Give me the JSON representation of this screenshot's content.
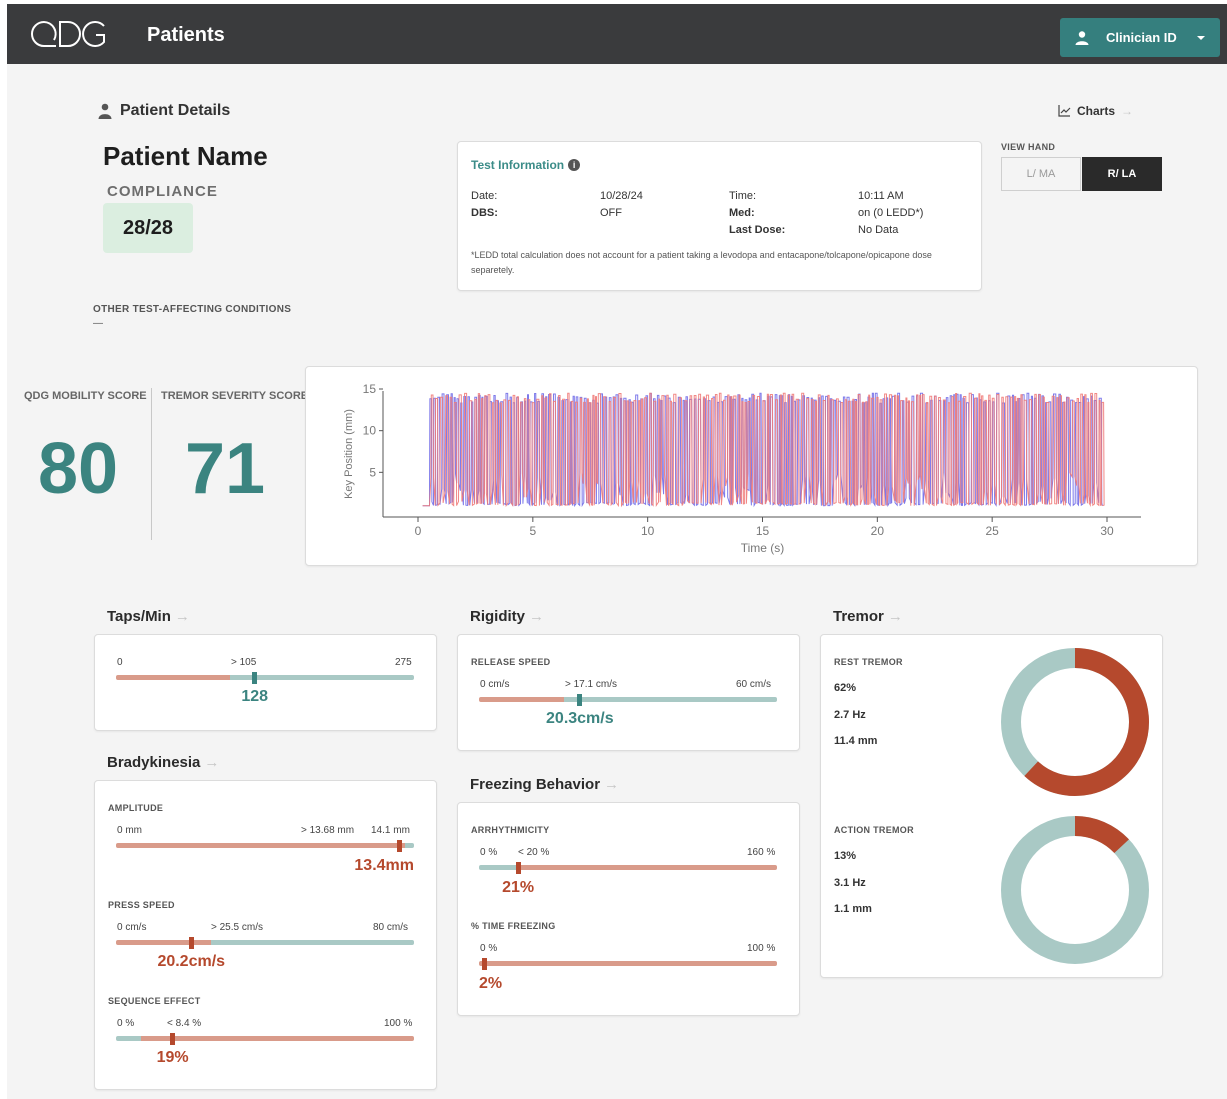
{
  "header": {
    "logo_text": "QDG",
    "title": "Patients",
    "clinician_label": "Clinician ID"
  },
  "patient": {
    "section_label": "Patient Details",
    "name": "Patient Name",
    "compliance_label": "COMPLIANCE",
    "compliance_value": "28/28",
    "other_conditions_label": "OTHER TEST-AFFECTING CONDITIONS",
    "other_conditions_value": "—"
  },
  "test_info": {
    "title": "Test Information",
    "date_label": "Date:",
    "date_value": "10/28/24",
    "time_label": "Time:",
    "time_value": "10:11 AM",
    "dbs_label": "DBS:",
    "dbs_value": "OFF",
    "med_label": "Med:",
    "med_value": "on (0 LEDD*)",
    "last_dose_label": "Last Dose:",
    "last_dose_value": "No Data",
    "note": "*LEDD total calculation does not account for a patient taking a levodopa and entacapone/tolcapone/opicapone dose separetely."
  },
  "charts_link": "Charts",
  "view_hand": {
    "label": "VIEW HAND",
    "left": "L/ MA",
    "right": "R/ LA",
    "selected": "right"
  },
  "scores": {
    "mobility_label": "QDG MOBILITY SCORE",
    "mobility_value": "80",
    "tremor_label": "TREMOR SEVERITY SCORE",
    "tremor_value": "71"
  },
  "chart_data": {
    "type": "line",
    "title": "",
    "xlabel": "Time (s)",
    "ylabel": "Key Position (mm)",
    "xlim": [
      0,
      30
    ],
    "ylim": [
      0,
      15
    ],
    "x_ticks": [
      "0",
      "5",
      "10",
      "15",
      "20",
      "25",
      "30"
    ],
    "y_ticks": [
      "5",
      "10",
      "15"
    ],
    "grid": false,
    "series": [
      {
        "color": "#6f6ae8",
        "taps_in_window": 128,
        "start": 0.5,
        "end": 29.8,
        "high": 14.5,
        "low": 1.0
      },
      {
        "color": "#ef7a78",
        "taps_in_window": 128,
        "start": 0.5,
        "end": 29.8,
        "high": 14.5,
        "low": 1.0
      }
    ]
  },
  "colors": {
    "teal": "#3b8480",
    "teal_light": "#a9c9c5",
    "salmon": "#d99b8a",
    "rust": "#b5492d",
    "header_bg": "#3a3b3d",
    "button_teal": "#357f7e"
  },
  "taps": {
    "title": "Taps/Min",
    "min": "0",
    "threshold": "> 105",
    "max": "275",
    "value": "128",
    "value_num": 128,
    "threshold_num": 105,
    "max_num": 275
  },
  "rigidity": {
    "title": "Rigidity",
    "sub": "RELEASE SPEED",
    "min": "0 cm/s",
    "threshold": "> 17.1 cm/s",
    "max": "60 cm/s",
    "value": "20.3cm/s",
    "value_num": 20.3,
    "threshold_num": 17.1,
    "max_num": 60
  },
  "bradykinesia": {
    "title": "Bradykinesia",
    "amplitude": {
      "sub": "AMPLITUDE",
      "min": "0 mm",
      "threshold": "> 13.68 mm",
      "max": "14.1 mm",
      "value": "13.4mm",
      "value_num": 13.4,
      "threshold_num": 13.68,
      "max_num": 14.1
    },
    "press_speed": {
      "sub": "PRESS SPEED",
      "min": "0 cm/s",
      "threshold": "> 25.5 cm/s",
      "max": "80 cm/s",
      "value": "20.2cm/s",
      "value_num": 20.2,
      "threshold_num": 25.5,
      "max_num": 80
    },
    "sequence_effect": {
      "sub": "SEQUENCE EFFECT",
      "min": "0 %",
      "threshold": "< 8.4 %",
      "max": "100 %",
      "value": "19%",
      "value_num": 19,
      "threshold_num": 8.4,
      "max_num": 100
    }
  },
  "freezing": {
    "title": "Freezing Behavior",
    "arrhythmicity": {
      "sub": "ARRHYTHMICITY",
      "min": "0 %",
      "threshold": "< 20 %",
      "max": "160 %",
      "value": "21%",
      "value_num": 21,
      "threshold_num": 20,
      "max_num": 160
    },
    "time_freezing": {
      "sub": "% TIME FREEZING",
      "min": "0 %",
      "max": "100 %",
      "value": "2%",
      "value_num": 2,
      "max_num": 100
    }
  },
  "tremor": {
    "title": "Tremor",
    "rest": {
      "label": "REST TREMOR",
      "percent": "62%",
      "percent_num": 62,
      "freq": "2.7 Hz",
      "amp": "11.4 mm"
    },
    "action": {
      "label": "ACTION TREMOR",
      "percent": "13%",
      "percent_num": 13,
      "freq": "3.1 Hz",
      "amp": "1.1 mm"
    }
  }
}
